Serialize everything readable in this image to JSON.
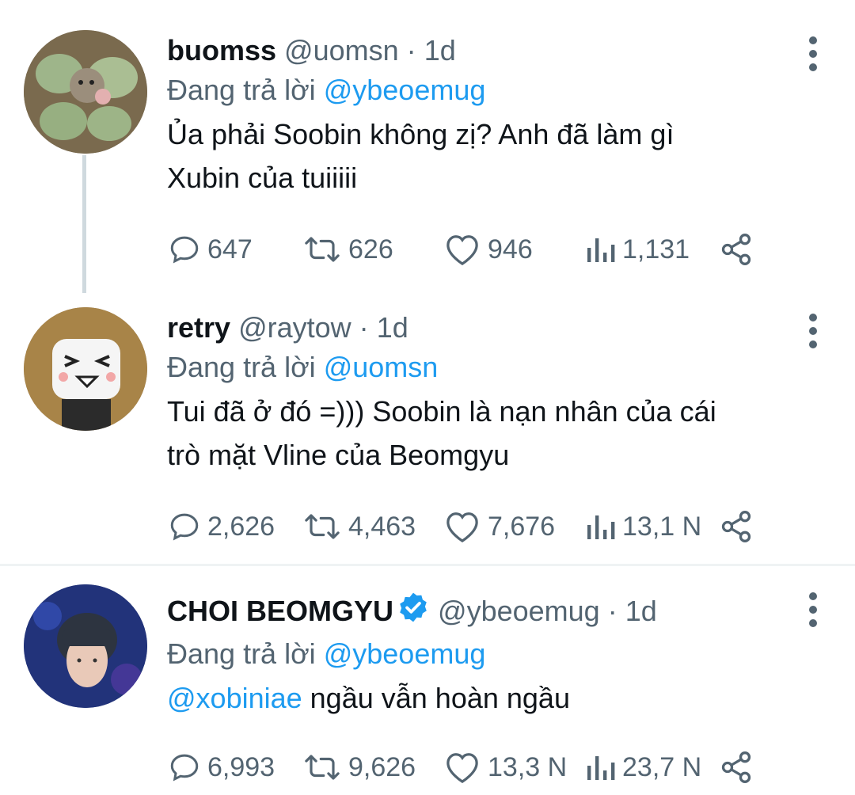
{
  "tweets": [
    {
      "name": "buomss",
      "handle": "@uomsn",
      "dot": "·",
      "time": "1d",
      "replying_prefix": "Đang trả lời",
      "replying_to": "@ybeoemug",
      "text_lines": [
        "Ủa phải Soobin không zị? Anh đã làm gì",
        "Xubin của tuiiiii"
      ],
      "replies": "647",
      "retweets": "626",
      "likes": "946",
      "views": "1,131"
    },
    {
      "name": "retry",
      "handle": "@raytow",
      "dot": "·",
      "time": "1d",
      "replying_prefix": "Đang trả lời",
      "replying_to": "@uomsn",
      "text_lines": [
        "Tui đã ở đó =))) Soobin là nạn nhân của cái",
        "trò mặt Vline của Beomgyu"
      ],
      "replies": "2,626",
      "retweets": "4,463",
      "likes": "7,676",
      "views": "13,1 N"
    },
    {
      "name": "CHOI BEOMGYU",
      "verified": true,
      "handle": "@ybeoemug",
      "dot": "·",
      "time": "1d",
      "replying_prefix": "Đang trả lời",
      "replying_to": "@ybeoemug",
      "text_mention": "@xobiniae",
      "text_rest": " ngầu vẫn hoàn ngầu",
      "replies": "6,993",
      "retweets": "9,626",
      "likes": "13,3 N",
      "views": "23,7 N"
    }
  ],
  "colors": {
    "text": "#0f1419",
    "secondary": "#536471",
    "link": "#1d9bf0",
    "thread_line": "#cfd9de",
    "divider": "#eff3f4"
  },
  "icons": [
    "reply-icon",
    "retweet-icon",
    "like-icon",
    "views-icon",
    "share-icon",
    "more-icon",
    "verified-badge-icon"
  ]
}
